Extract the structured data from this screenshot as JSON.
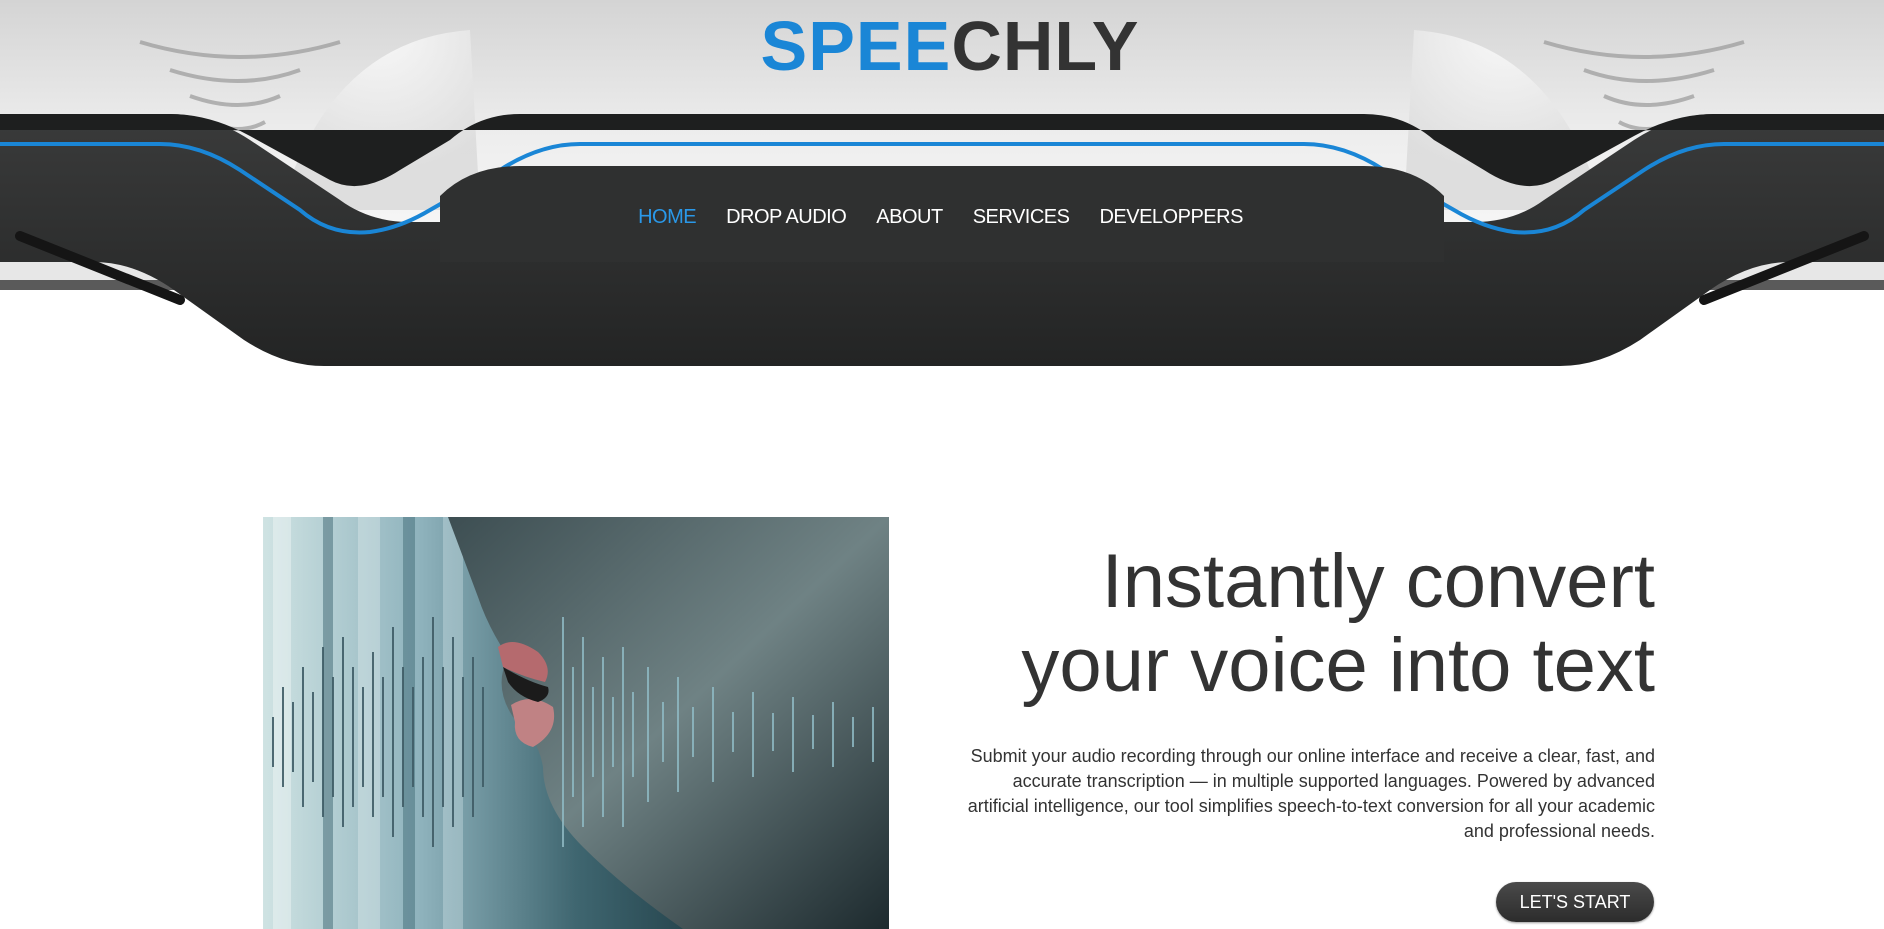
{
  "logo": {
    "part1": "SPEE",
    "part2": "CHLY"
  },
  "nav": {
    "items": [
      {
        "label": "HOME",
        "active": true
      },
      {
        "label": "DROP AUDIO",
        "active": false
      },
      {
        "label": "ABOUT",
        "active": false
      },
      {
        "label": "SERVICES",
        "active": false
      },
      {
        "label": "DEVELOPPERS",
        "active": false
      }
    ]
  },
  "hero": {
    "headline_line1": "Instantly convert",
    "headline_line2": "your voice into text",
    "paragraph": "Submit your audio recording through our online interface and receive a clear, fast, and accurate transcription — in multiple supported languages. Powered by advanced artificial intelligence, our tool simplifies speech-to-text conversion for all your academic and professional needs.",
    "cta_label": "LET'S START",
    "image_icon": "speaking-mouth-soundwave-image"
  },
  "colors": {
    "accent": "#1a86d6",
    "nav_active": "#2a98e8",
    "dark_band": "#2b2c2c",
    "text": "#333333"
  }
}
